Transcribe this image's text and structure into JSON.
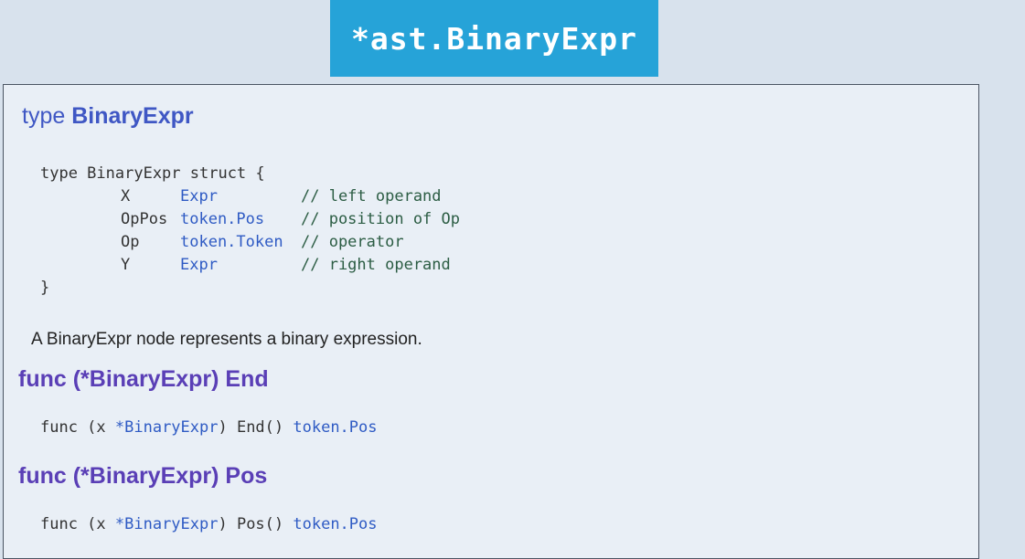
{
  "banner": {
    "title": "*ast.BinaryExpr"
  },
  "type_heading": {
    "keyword": "type",
    "name": "BinaryExpr"
  },
  "struct": {
    "open": "type BinaryExpr struct {",
    "fields": [
      {
        "name": "X",
        "type": "Expr",
        "comment": "// left operand"
      },
      {
        "name": "OpPos",
        "type": "token.Pos",
        "comment": "// position of Op"
      },
      {
        "name": "Op",
        "type": "token.Token",
        "comment": "// operator"
      },
      {
        "name": "Y",
        "type": "Expr",
        "comment": "// right operand"
      }
    ],
    "close": "}"
  },
  "description": "A BinaryExpr node represents a binary expression.",
  "methods": [
    {
      "heading": "func (*BinaryExpr) End",
      "sig_prefix": "func (x ",
      "receiver": "*BinaryExpr",
      "sig_middle": ") End() ",
      "return_type": "token.Pos"
    },
    {
      "heading": "func (*BinaryExpr) Pos",
      "sig_prefix": "func (x ",
      "receiver": "*BinaryExpr",
      "sig_middle": ") Pos() ",
      "return_type": "token.Pos"
    }
  ],
  "colors": {
    "banner_bg": "#26a3d8",
    "type_heading": "#3f57c4",
    "func_heading": "#5a3fb6",
    "code_type": "#2f5bc4",
    "code_comment": "#2c5d44"
  }
}
